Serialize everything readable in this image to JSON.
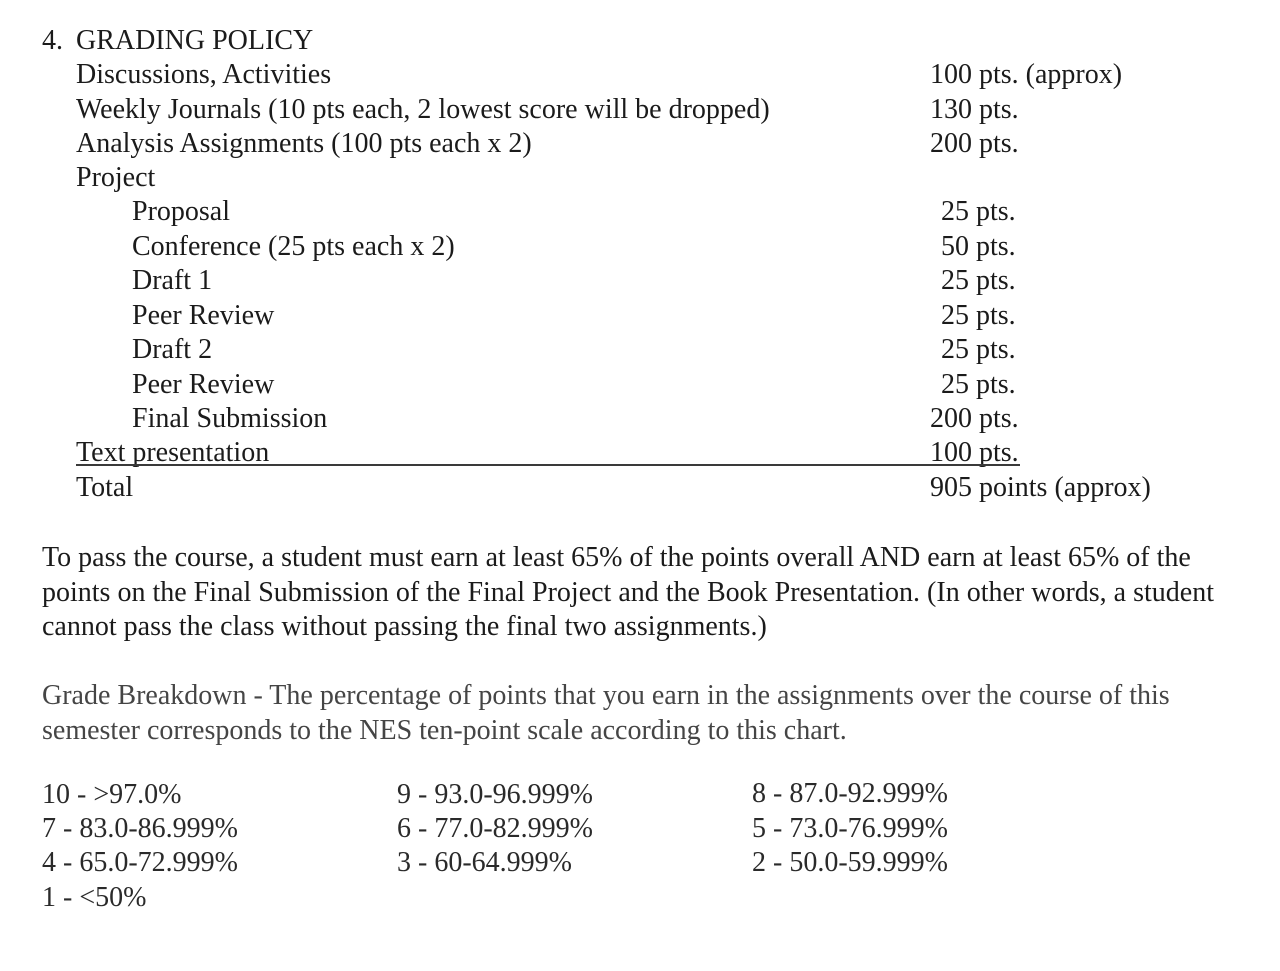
{
  "grading_policy": {
    "number": "4.",
    "title": "GRADING POLICY",
    "items": [
      {
        "label": "Discussions, Activities",
        "points": "100 pts. (approx)"
      },
      {
        "label": "Weekly Journals (10 pts each, 2 lowest score will be dropped)",
        "points": "130 pts."
      },
      {
        "label": "Analysis Assignments (100 pts each x 2)",
        "points": "200 pts."
      },
      {
        "label": "Project",
        "points": ""
      },
      {
        "label": "Proposal",
        "points": "25 pts."
      },
      {
        "label": "Conference (25 pts each x 2)",
        "points": "50 pts."
      },
      {
        "label": "Draft 1",
        "points": "25 pts."
      },
      {
        "label": "Peer Review",
        "points": "25 pts."
      },
      {
        "label": "Draft 2",
        "points": "25 pts."
      },
      {
        "label": "Peer Review",
        "points": "25 pts."
      },
      {
        "label": "Final Submission",
        "points": "200 pts."
      },
      {
        "label": "Text presentation",
        "points": "100 pts."
      }
    ],
    "total": {
      "label": "Total",
      "points": "905 points (approx)"
    }
  },
  "pass_requirement": "To pass the course, a student must earn at least 65% of the points overall AND earn at least 65% of the points on the Final Submission of the Final Project and the Book Presentation. (In other words, a student cannot pass the class without passing the final two assignments.)",
  "grade_breakdown": "Grade Breakdown - The percentage of points that you earn in the assignments over the course of this semester corresponds to the NES ten-point scale according to this chart.",
  "scale": [
    "10 - >97.0%",
    "9 - 93.0-96.999%",
    "8 - 87.0-92.999%",
    "7 - 83.0-86.999%",
    "6 - 77.0-82.999%",
    "5 - 73.0-76.999%",
    "4 - 65.0-72.999%",
    "3 - 60-64.999%",
    "2 - 50.0-59.999%",
    "1 - <50%"
  ]
}
